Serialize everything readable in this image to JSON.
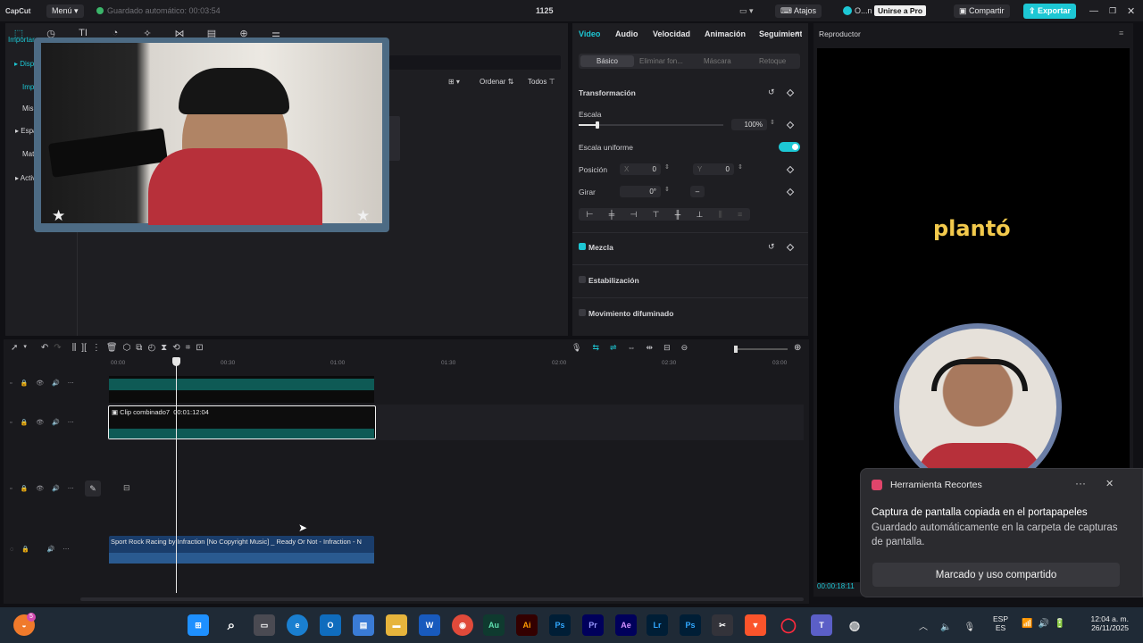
{
  "titlebar": {
    "app": "CapCut",
    "menu": "Menú",
    "autosave": "Guardado automático: 00:03:54",
    "project": "1125",
    "shortcuts": "Atajos",
    "user": "O...n",
    "join_pro": "Unirse a Pro",
    "share": "Compartir",
    "export": "Exportar"
  },
  "media": {
    "import": "Importar",
    "sidebar": [
      "Dispositivo",
      "Importar",
      "Mis",
      "Espacio",
      "Mat",
      "Activo"
    ],
    "sort": "Ordenar",
    "all": "Todos"
  },
  "props": {
    "tabs": [
      "Video",
      "Audio",
      "Velocidad",
      "Animación",
      "Seguimiento"
    ],
    "subtabs": [
      "Básico",
      "Eliminar fon...",
      "Máscara",
      "Retoque"
    ],
    "transform": "Transformación",
    "scale_label": "Escala",
    "scale_value": "100%",
    "scale_fraction": 0.13,
    "uniform": "Escala uniforme",
    "position": "Posición",
    "x_label": "X",
    "x_value": "0",
    "y_label": "Y",
    "y_value": "0",
    "rotate": "Girar",
    "rotate_value": "0°",
    "blend": "Mezcla",
    "stabilize": "Estabilización",
    "blur": "Movimiento difuminado"
  },
  "player": {
    "title": "Reproductor",
    "caption": "plantó",
    "time": "00:00:18:11"
  },
  "timeline": {
    "ruler": [
      "00:00",
      "00:30",
      "01:00",
      "01:30",
      "02:00",
      "02:30",
      "03:00"
    ],
    "clip_label": "Clip combinado7",
    "clip_duration": "00:01:12:04",
    "audio_label": "Sport Rock Racing by Infraction [No Copyright Music] _ Ready Or Not - Infraction - N"
  },
  "toast": {
    "app": "Herramienta Recortes",
    "title": "Captura de pantalla copiada en el portapapeles",
    "body": "Guardado automáticamente en la carpeta de capturas de pantalla.",
    "action": "Marcado y uso compartido"
  },
  "taskbar": {
    "lang1": "ESP",
    "lang2": "ES",
    "time": "12:04 a. m.",
    "date": "26/11/2025",
    "badge": "5",
    "apps": [
      "Au",
      "Ai",
      "Ps",
      "Pr",
      "Ae",
      "Lr",
      "Ps"
    ]
  },
  "colors": {
    "accent": "#1dc7d4",
    "teal_clip": "#0e5a55",
    "audio_clip": "#1a3d6b",
    "webcam_border": "#4d6b84"
  }
}
